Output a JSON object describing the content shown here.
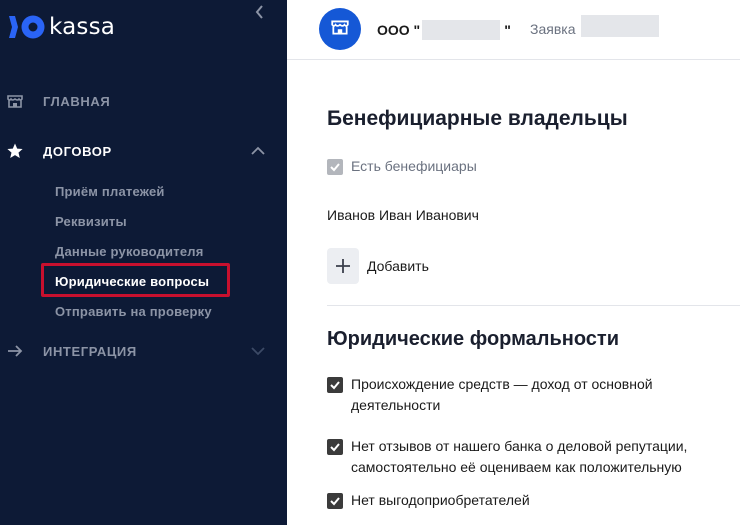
{
  "sidebar": {
    "logo_text": "kassa",
    "nav": {
      "main": "ГЛАВНАЯ",
      "contract": "ДОГОВОР",
      "integration": "ИНТЕГРАЦИЯ"
    },
    "sub_items": [
      "Приём платежей",
      "Реквизиты",
      "Данные руководителя",
      "Юридические вопросы",
      "Отправить на проверку"
    ],
    "active_sub_item": "Юридические вопросы"
  },
  "header": {
    "org_prefix": "ООО \"",
    "org_suffix": "\"",
    "application_label": "Заявка"
  },
  "beneficiaries": {
    "title": "Бенефициарные владельцы",
    "has_beneficiaries_label": "Есть бенефициары",
    "owner_name": "Иванов Иван Иванович",
    "add_label": "Добавить"
  },
  "legal": {
    "title": "Юридические формальности",
    "items": [
      "Происхождение средств — доход от основной деятельности",
      "Нет отзывов от нашего банка о деловой репутации, самостоятельно её оцениваем как положительную",
      "Нет выгодоприобретателей"
    ]
  },
  "colors": {
    "sidebar_bg": "#0d1a36",
    "brand_blue": "#1558d6",
    "highlight_red": "#c8102e"
  },
  "icons": {
    "logo": "yoo-logo-icon",
    "collapse": "chevron-left-icon",
    "main": "storefront-icon",
    "contract": "star-icon",
    "integration": "arrow-right-icon",
    "org": "storefront-icon"
  }
}
